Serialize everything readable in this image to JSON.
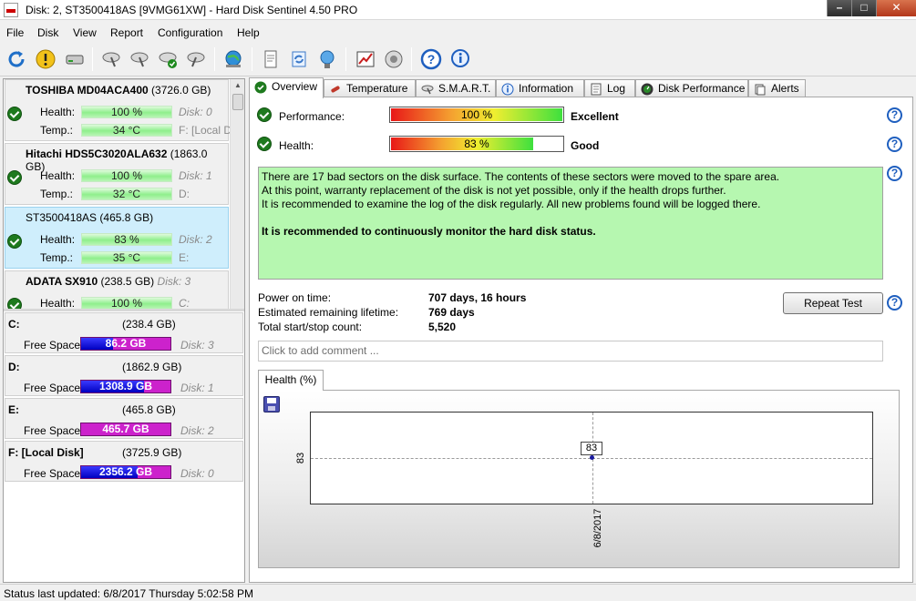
{
  "window": {
    "title": "Disk: 2, ST3500418AS [9VMG61XW]  -  Hard Disk Sentinel 4.50 PRO",
    "minimize_glyph": "–",
    "maximize_glyph": "□",
    "close_glyph": "✕"
  },
  "menu": [
    "File",
    "Disk",
    "View",
    "Report",
    "Configuration",
    "Help"
  ],
  "disks": [
    {
      "name": "TOSHIBA MD04ACA400",
      "size": "(3726.0 GB)",
      "health": "100 %",
      "temp": "34 °C",
      "disk_no": "Disk: 0",
      "volumes": "F: [Local D",
      "health_label": "Health:",
      "temp_label": "Temp.:"
    },
    {
      "name": "Hitachi HDS5C3020ALA632",
      "size": "(1863.0 GB)",
      "health": "100 %",
      "temp": "32 °C",
      "disk_no": "Disk: 1",
      "volumes": "D:",
      "health_label": "Health:",
      "temp_label": "Temp.:"
    },
    {
      "name": "ST3500418AS",
      "size": "(465.8 GB)",
      "health": "83 %",
      "temp": "35 °C",
      "disk_no": "Disk: 2",
      "volumes": "E:",
      "health_label": "Health:",
      "temp_label": "Temp.:"
    },
    {
      "name": "ADATA SX910",
      "size": "(238.5 GB)",
      "health": "100 %",
      "disk_no": "Disk: 3",
      "volumes": "C:",
      "health_label": "Health:"
    }
  ],
  "volumes": [
    {
      "letter": "C:",
      "size": "(238.4 GB)",
      "free_label": "Free Space",
      "free": "86.2 GB",
      "free_fraction": 0.36,
      "disk": "Disk: 3"
    },
    {
      "letter": "D:",
      "size": "(1862.9 GB)",
      "free_label": "Free Space",
      "free": "1308.9 GB",
      "free_fraction": 0.7,
      "disk": "Disk: 1"
    },
    {
      "letter": "E:",
      "size": "(465.8 GB)",
      "free_label": "Free Space",
      "free": "465.7 GB",
      "free_fraction": 0.0,
      "disk": "Disk: 2"
    },
    {
      "letter": "F: [Local Disk]",
      "size": "(3725.9 GB)",
      "free_label": "Free Space",
      "free": "2356.2 GB",
      "free_fraction": 0.63,
      "disk": "Disk: 0"
    }
  ],
  "tabs": [
    "Overview",
    "Temperature",
    "S.M.A.R.T.",
    "Information",
    "Log",
    "Disk Performance",
    "Alerts"
  ],
  "overview": {
    "performance_label": "Performance:",
    "performance_value": "100 %",
    "performance_fraction": 1.0,
    "performance_rating": "Excellent",
    "health_label": "Health:",
    "health_value": "83 %",
    "health_fraction": 0.83,
    "health_rating": "Good",
    "help_glyph": "?",
    "notice_lines": [
      "There are 17 bad sectors on the disk surface. The contents of these sectors were moved to the spare area.",
      "At this point, warranty replacement of the disk is not yet possible, only if the health drops further.",
      "It is recommended to examine the log of the disk regularly. All new problems found will be logged there."
    ],
    "notice_strong": "It is recommended to continuously monitor the hard disk status.",
    "power_on_label": "Power on time:",
    "power_on_value": "707 days, 16 hours",
    "lifetime_label": "Estimated remaining lifetime:",
    "lifetime_value": "769 days",
    "startstop_label": "Total start/stop count:",
    "startstop_value": "5,520",
    "repeat_test": "Repeat Test",
    "comment_placeholder": "Click to add comment ..."
  },
  "chart_tab": "Health (%)",
  "chart_data": {
    "type": "line",
    "x": [
      "6/8/2017"
    ],
    "series": [
      {
        "values": [
          83
        ]
      }
    ],
    "y_tick": "83",
    "data_label": "83",
    "x_tick": "6/8/2017",
    "grid": true
  },
  "status": "Status last updated: 6/8/2017 Thursday 5:02:58 PM"
}
